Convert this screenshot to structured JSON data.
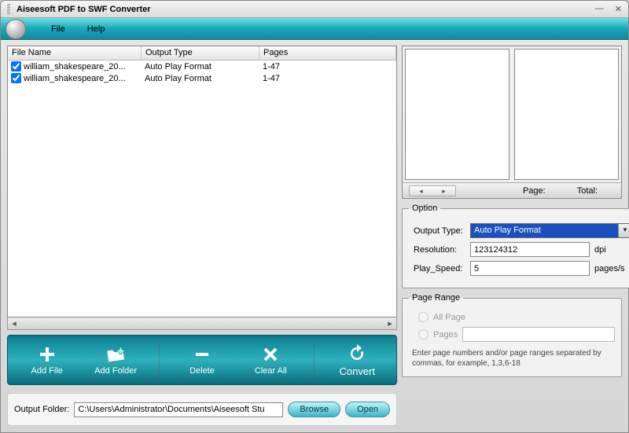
{
  "title": "Aiseesoft PDF to SWF Converter",
  "menu": {
    "file": "File",
    "help": "Help"
  },
  "columns": {
    "name": "File Name",
    "type": "Output Type",
    "pages": "Pages"
  },
  "rows": [
    {
      "name": "william_shakespeare_20...",
      "type": "Auto Play Format",
      "pages": "1-47"
    },
    {
      "name": "william_shakespeare_20...",
      "type": "Auto Play Format",
      "pages": "1-47"
    }
  ],
  "toolbar": {
    "add_file": "Add File",
    "add_folder": "Add Folder",
    "delete": "Delete",
    "clear_all": "Clear All",
    "convert": "Convert"
  },
  "output": {
    "label": "Output Folder:",
    "path": "C:\\Users\\Administrator\\Documents\\Aiseesoft Stu",
    "browse": "Browse",
    "open": "Open"
  },
  "preview": {
    "page_label": "Page:",
    "total_label": "Total:"
  },
  "option": {
    "legend": "Option",
    "output_type_label": "Output Type:",
    "output_type_value": "Auto Play Format",
    "resolution_label": "Resolution:",
    "resolution_value": "123124312",
    "resolution_unit": "dpi",
    "play_speed_label": "Play_Speed:",
    "play_speed_value": "5",
    "play_speed_unit": "pages/s"
  },
  "range": {
    "legend": "Page Range",
    "all": "All Page",
    "pages": "Pages",
    "hint": "Enter page numbers and/or page ranges separated by commas, for example, 1,3,6-18"
  }
}
